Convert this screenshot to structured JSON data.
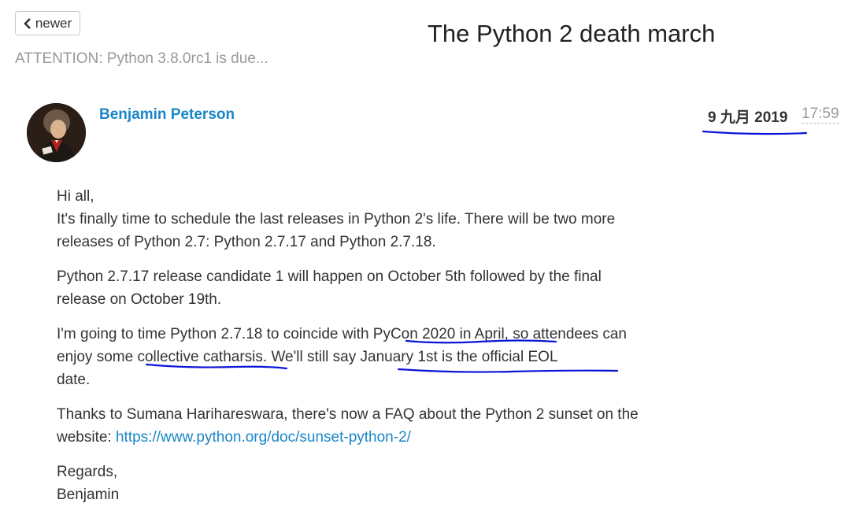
{
  "nav": {
    "newer_label": "newer"
  },
  "thread": {
    "title": "The Python 2 death march"
  },
  "previous": {
    "label": "ATTENTION: Python 3.8.0rc1 is due..."
  },
  "message": {
    "author": "Benjamin Peterson",
    "date": "9 九月 2019",
    "time": "17:59",
    "body": {
      "p1": [
        "Hi all,",
        "It's finally time to schedule the last releases in Python 2's life. There will be two more",
        "releases of Python 2.7: Python 2.7.17 and Python 2.7.18."
      ],
      "p2": [
        "Python 2.7.17 release candidate 1 will happen on October 5th followed by the final",
        "release on October 19th."
      ],
      "p3": [
        "I'm going to time Python 2.7.18 to coincide with PyCon 2020 in April, so attendees can",
        "enjoy some collective catharsis. We'll still say January 1st is the official EOL",
        "date."
      ],
      "p4_text": [
        "Thanks to Sumana Harihareswara, there's now a FAQ about the Python 2 sunset on the",
        "website: "
      ],
      "p4_link": "https://www.python.org/doc/sunset-python-2/",
      "p5": [
        "Regards,",
        "Benjamin"
      ]
    }
  },
  "colors": {
    "link": "#1a86c8",
    "text": "#333333",
    "muted": "#999999",
    "annotation": "#0a14d8"
  }
}
